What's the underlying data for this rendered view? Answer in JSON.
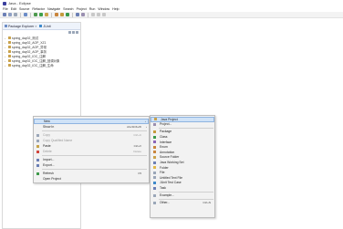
{
  "window": {
    "title": "Java - Eclipse"
  },
  "menubar": [
    "File",
    "Edit",
    "Source",
    "Refactor",
    "Navigate",
    "Search",
    "Project",
    "Run",
    "Window",
    "Help"
  ],
  "explorer": {
    "tab_label": "Package Explorer",
    "tab_close": "×",
    "tab2_label": "JUnit",
    "projects": [
      "spring_day02_测试",
      "spring_day02_AOP_XZ1",
      "spring_day02_AOP_异常",
      "spring_day02_AOP_事务",
      "spring_day02_IOC_注解",
      "spring_day02_IOC_注解_回调对象",
      "spring_day02_IOC_注解_生命"
    ]
  },
  "context_menu": {
    "items": [
      {
        "label": "New",
        "shortcut": "",
        "arrow": "›",
        "highlight": true,
        "disabled": false,
        "icon": "none",
        "color": "#000000"
      },
      {
        "label": "Show In",
        "shortcut": "Alt+Shift+W",
        "arrow": "›",
        "highlight": false,
        "disabled": false,
        "icon": "none",
        "color": "#000000"
      },
      {
        "sep": true
      },
      {
        "label": "Copy",
        "shortcut": "Ctrl+C",
        "arrow": "",
        "highlight": false,
        "disabled": true,
        "icon": "copy-icon",
        "color": "#9aa6b8"
      },
      {
        "label": "Copy Qualified Name",
        "shortcut": "",
        "arrow": "",
        "highlight": false,
        "disabled": true,
        "icon": "copy-icon",
        "color": "#9aa6b8"
      },
      {
        "label": "Paste",
        "shortcut": "Ctrl+V",
        "arrow": "",
        "highlight": false,
        "disabled": false,
        "icon": "paste-icon",
        "color": "#c7a44a"
      },
      {
        "label": "Delete",
        "shortcut": "Delete",
        "arrow": "",
        "highlight": false,
        "disabled": true,
        "icon": "delete-icon",
        "color": "#d0453c"
      },
      {
        "sep": true
      },
      {
        "label": "Import...",
        "shortcut": "",
        "arrow": "",
        "highlight": false,
        "disabled": false,
        "icon": "import-icon",
        "color": "#6b7fb5"
      },
      {
        "label": "Export...",
        "shortcut": "",
        "arrow": "",
        "highlight": false,
        "disabled": false,
        "icon": "export-icon",
        "color": "#6b7fb5"
      },
      {
        "sep": true
      },
      {
        "label": "Refresh",
        "shortcut": "F5",
        "arrow": "",
        "highlight": false,
        "disabled": false,
        "icon": "refresh-icon",
        "color": "#3e9a4a"
      },
      {
        "label": "Open Project",
        "shortcut": "",
        "arrow": "",
        "highlight": false,
        "disabled": false,
        "icon": "none",
        "color": "#000000"
      }
    ]
  },
  "submenu": {
    "items": [
      {
        "label": "Java Project",
        "shortcut": "",
        "highlight": true,
        "icon": "java-project-icon",
        "color": "#c9a24b"
      },
      {
        "label": "Project...",
        "shortcut": "",
        "highlight": false,
        "icon": "project-icon",
        "color": "#9a8fb0"
      },
      {
        "sep": true
      },
      {
        "label": "Package",
        "shortcut": "",
        "highlight": false,
        "icon": "package-icon",
        "color": "#c59a3c"
      },
      {
        "label": "Class",
        "shortcut": "",
        "highlight": false,
        "icon": "class-icon",
        "color": "#3a9a4a"
      },
      {
        "label": "Interface",
        "shortcut": "",
        "highlight": false,
        "icon": "interface-icon",
        "color": "#8a64b8"
      },
      {
        "label": "Enum",
        "shortcut": "",
        "highlight": false,
        "icon": "enum-icon",
        "color": "#c9853c"
      },
      {
        "label": "Annotation",
        "shortcut": "",
        "highlight": false,
        "icon": "annotation-icon",
        "color": "#c9853c"
      },
      {
        "label": "Source Folder",
        "shortcut": "",
        "highlight": false,
        "icon": "source-folder-icon",
        "color": "#c9a24b"
      },
      {
        "label": "Java Working Set",
        "shortcut": "",
        "highlight": false,
        "icon": "working-set-icon",
        "color": "#6b7fb5"
      },
      {
        "label": "Folder",
        "shortcut": "",
        "highlight": false,
        "icon": "folder-icon",
        "color": "#e0b848"
      },
      {
        "label": "File",
        "shortcut": "",
        "highlight": false,
        "icon": "file-icon",
        "color": "#9aa6b8"
      },
      {
        "label": "Untitled Text File",
        "shortcut": "",
        "highlight": false,
        "icon": "text-file-icon",
        "color": "#9aa6b8"
      },
      {
        "label": "JUnit Test Case",
        "shortcut": "",
        "highlight": false,
        "icon": "junit-icon",
        "color": "#3e8acb"
      },
      {
        "label": "Task",
        "shortcut": "",
        "highlight": false,
        "icon": "task-icon",
        "color": "#6b7fb5"
      },
      {
        "sep": true
      },
      {
        "label": "Example...",
        "shortcut": "",
        "highlight": false,
        "icon": "example-icon",
        "color": "#9aa6b8"
      },
      {
        "sep": true
      },
      {
        "label": "Other...",
        "shortcut": "Ctrl+N",
        "highlight": false,
        "icon": "other-icon",
        "color": "#9aa6b8"
      }
    ]
  }
}
